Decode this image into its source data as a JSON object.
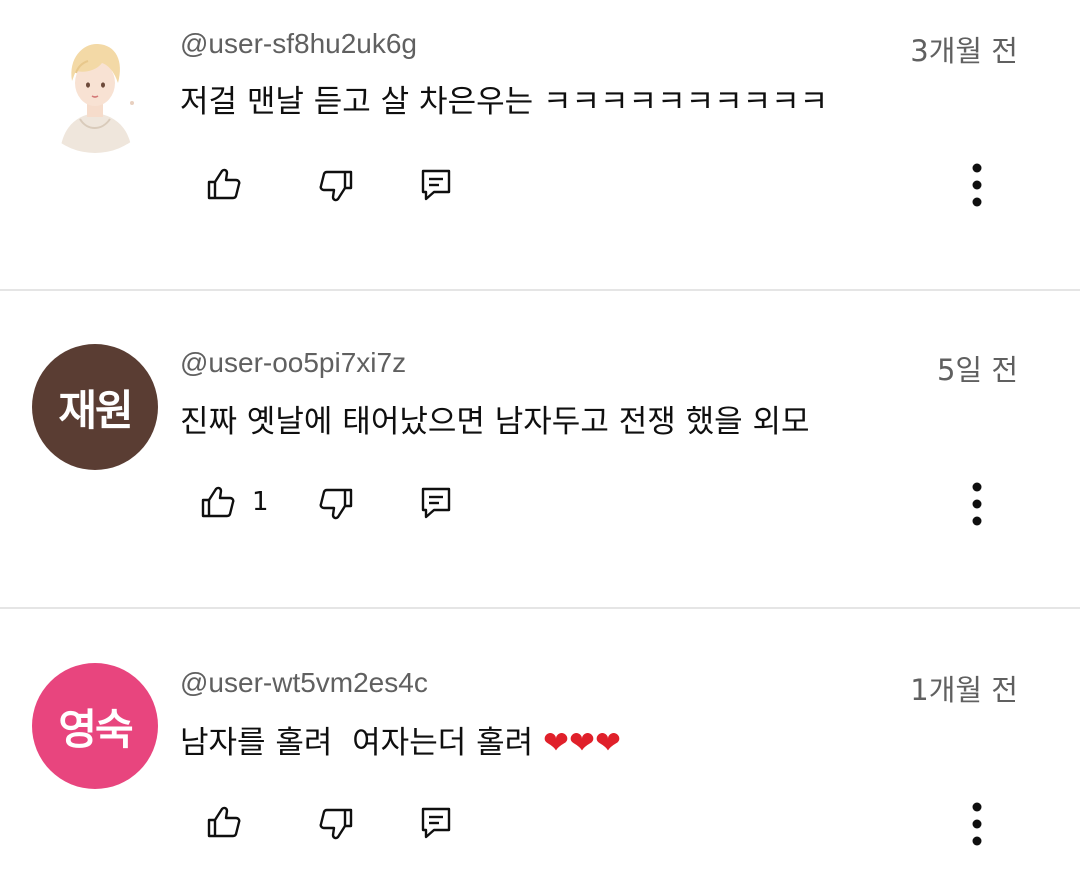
{
  "comments": [
    {
      "handle": "@user-sf8hu2uk6g",
      "time": "3개월 전",
      "text": "저걸 맨날 듣고 살 차은우는 ㅋㅋㅋㅋㅋㅋㅋㅋㅋㅋ",
      "avatar_text": "",
      "likes": ""
    },
    {
      "handle": "@user-oo5pi7xi7z",
      "time": "5일 전",
      "text": "진짜 옛날에 태어났으면 남자두고 전쟁 했을 외모",
      "avatar_text": "재원",
      "likes": "1"
    },
    {
      "handle": "@user-wt5vm2es4c",
      "time": "1개월 전",
      "text": "남자를 홀려  여자는더 홀려 ",
      "hearts": "❤❤❤",
      "avatar_text": "영숙",
      "likes": ""
    }
  ],
  "icons": {
    "like": "thumbs-up-icon",
    "dislike": "thumbs-down-icon",
    "reply": "reply-icon",
    "more": "more-vert-icon"
  },
  "colors": {
    "avatar_brown": "#5a3d33",
    "avatar_pink": "#e8457e",
    "heart": "#e0202a",
    "meta_text": "#606060"
  }
}
